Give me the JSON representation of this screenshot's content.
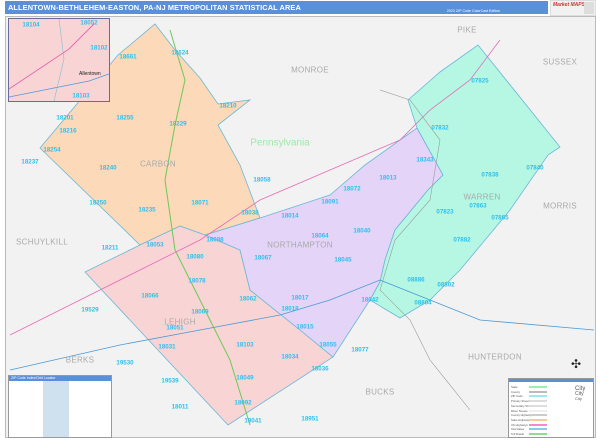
{
  "header": {
    "title": "ALLENTOWN-BETHLEHEM-EASTON, PA-NJ METROPOLITAN STATISTICAL AREA",
    "subtitle": "2023 ZIP Code ColorCast Edition",
    "logo_text": "Market MAPS"
  },
  "colors": {
    "carbon": "#fcd9b8",
    "lehigh": "#f9d4d4",
    "northampton": "#e3d4f8",
    "warren": "#b5f7e3",
    "zip_label": "#2fc0ef",
    "header": "#5b8fd8"
  },
  "state_label": "Pennsylvania",
  "counties": [
    "PIKE",
    "SUSSEX",
    "MONROE",
    "CARBON",
    "SCHUYLKILL",
    "MORRIS",
    "WARREN",
    "NORTHAMPTON",
    "LEHIGH",
    "BERKS",
    "HUNTERDON",
    "BUCKS"
  ],
  "inset": {
    "city": "Allentown",
    "zips": [
      "18104",
      "18052",
      "18102",
      "18103"
    ]
  },
  "zips": [
    "18661",
    "18624",
    "18210",
    "18229",
    "18255",
    "18201",
    "18216",
    "18254",
    "18237",
    "18240",
    "18250",
    "18235",
    "18071",
    "18058",
    "18211",
    "18053",
    "18038",
    "18014",
    "18091",
    "18072",
    "18013",
    "18343",
    "18040",
    "18064",
    "18088",
    "18080",
    "18067",
    "18045",
    "18078",
    "18066",
    "18069",
    "18062",
    "18017",
    "18018",
    "18015",
    "18051",
    "18031",
    "18103",
    "18034",
    "18055",
    "18077",
    "18036",
    "18049",
    "18092",
    "18041",
    "18951",
    "19539",
    "18011",
    "19530",
    "19529",
    "07825",
    "07832",
    "07840",
    "07838",
    "07863",
    "07823",
    "07865",
    "07882",
    "08886",
    "08802",
    "08804",
    "18042"
  ],
  "index_table": {
    "title": "ZIP Code Index/Grid Locator"
  },
  "legend": {
    "items": [
      "State",
      "County",
      "ZIP Code",
      "Primary Streets",
      "Secondary Streets",
      "Minor Streets",
      "County Highways",
      "State Highways",
      "US Highways",
      "Interstates",
      "Toll Roads"
    ],
    "city_labels": [
      "City",
      "City",
      "City"
    ]
  }
}
